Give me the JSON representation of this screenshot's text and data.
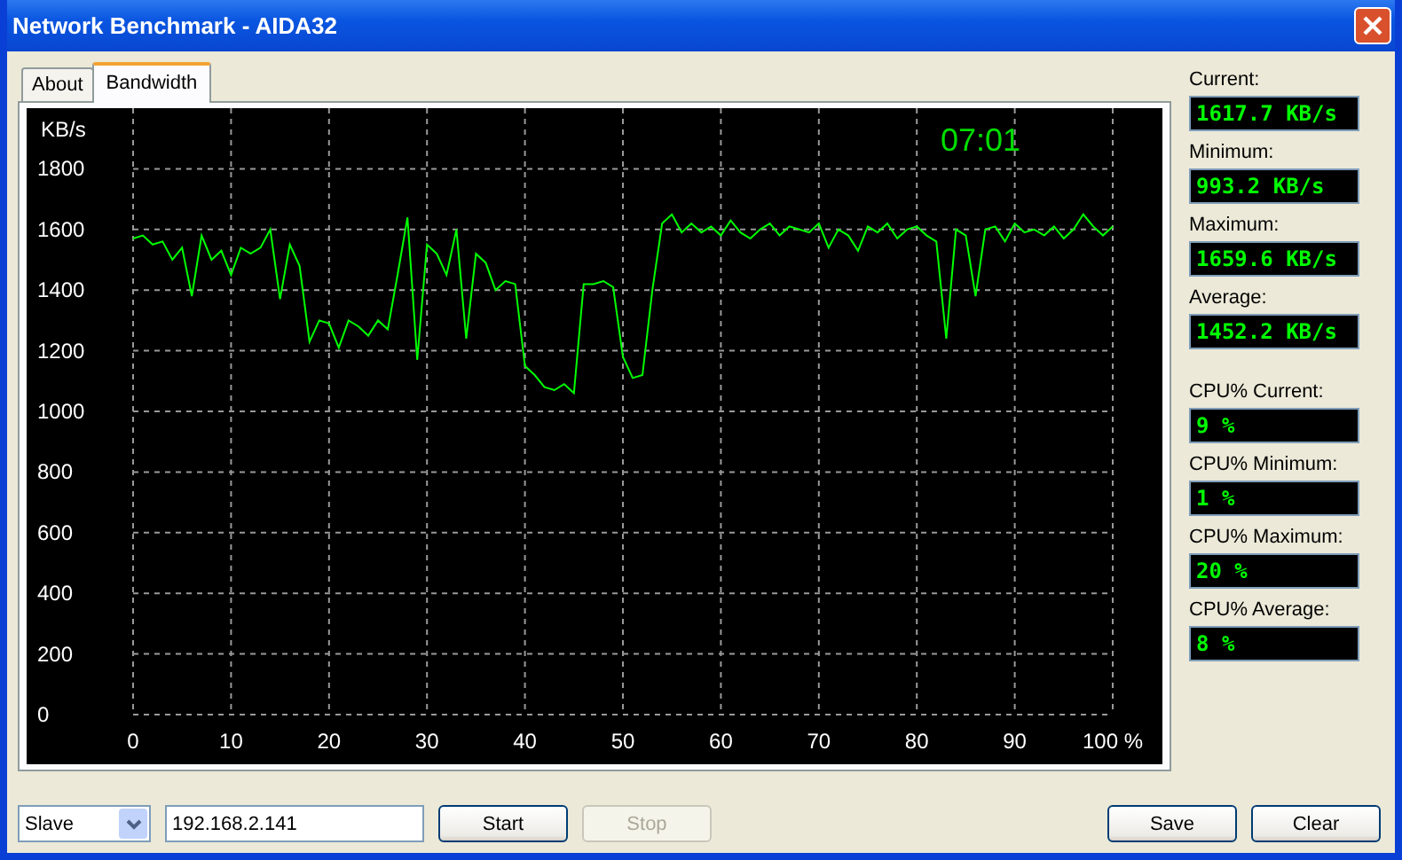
{
  "window": {
    "title": "Network Benchmark - AIDA32"
  },
  "tabs": [
    {
      "label": "About",
      "selected": false
    },
    {
      "label": "Bandwidth",
      "selected": true
    }
  ],
  "graph": {
    "timer": "07:01",
    "chart_data": {
      "type": "line",
      "ylabel": "KB/s",
      "x": [
        0,
        1,
        2,
        3,
        4,
        5,
        6,
        7,
        8,
        9,
        10,
        11,
        12,
        13,
        14,
        15,
        16,
        17,
        18,
        19,
        20,
        21,
        22,
        23,
        24,
        25,
        26,
        27,
        28,
        29,
        30,
        31,
        32,
        33,
        34,
        35,
        36,
        37,
        38,
        39,
        40,
        41,
        42,
        43,
        44,
        45,
        46,
        47,
        48,
        49,
        50,
        51,
        52,
        53,
        54,
        55,
        56,
        57,
        58,
        59,
        60,
        61,
        62,
        63,
        64,
        65,
        66,
        67,
        68,
        69,
        70,
        71,
        72,
        73,
        74,
        75,
        76,
        77,
        78,
        79,
        80,
        81,
        82,
        83,
        84,
        85,
        86,
        87,
        88,
        89,
        90,
        91,
        92,
        93,
        94,
        95,
        96,
        97,
        98,
        99,
        100
      ],
      "series": [
        {
          "color": "#00ff00",
          "values": [
            1570,
            1580,
            1550,
            1560,
            1500,
            1540,
            1380,
            1580,
            1500,
            1530,
            1450,
            1540,
            1520,
            1540,
            1600,
            1370,
            1550,
            1480,
            1230,
            1300,
            1290,
            1210,
            1300,
            1280,
            1250,
            1300,
            1270,
            1450,
            1640,
            1170,
            1550,
            1520,
            1450,
            1600,
            1240,
            1520,
            1490,
            1400,
            1430,
            1420,
            1150,
            1120,
            1080,
            1070,
            1090,
            1060,
            1420,
            1420,
            1430,
            1410,
            1180,
            1110,
            1120,
            1400,
            1620,
            1650,
            1590,
            1620,
            1590,
            1610,
            1580,
            1630,
            1590,
            1570,
            1600,
            1620,
            1580,
            1610,
            1600,
            1590,
            1620,
            1540,
            1600,
            1580,
            1530,
            1610,
            1590,
            1620,
            1570,
            1600,
            1610,
            1580,
            1560,
            1240,
            1600,
            1580,
            1380,
            1600,
            1610,
            1560,
            1620,
            1590,
            1600,
            1580,
            1610,
            1570,
            1600,
            1650,
            1610,
            1580,
            1610
          ]
        }
      ],
      "grid": true,
      "xlim": [
        0,
        100
      ],
      "ylim": [
        0,
        2000
      ],
      "xticks": [
        0,
        10,
        20,
        30,
        40,
        50,
        60,
        70,
        80,
        90,
        {
          "value": 100,
          "label": "100 %"
        }
      ],
      "yticks": [
        0,
        200,
        400,
        600,
        800,
        1000,
        1200,
        1400,
        1600,
        1800
      ]
    }
  },
  "stats": [
    {
      "label": "Current:",
      "value": "1617.7 KB/s"
    },
    {
      "label": "Minimum:",
      "value": "993.2 KB/s"
    },
    {
      "label": "Maximum:",
      "value": "1659.6 KB/s"
    },
    {
      "label": "Average:",
      "value": "1452.2 KB/s"
    },
    {
      "label": "CPU% Current:",
      "value": "9 %"
    },
    {
      "label": "CPU% Minimum:",
      "value": "1 %"
    },
    {
      "label": "CPU% Maximum:",
      "value": "20 %"
    },
    {
      "label": "CPU% Average:",
      "value": "8 %"
    }
  ],
  "mode": {
    "value": "Slave"
  },
  "address": {
    "value": "192.168.2.141"
  },
  "buttons": [
    {
      "label": "Start",
      "disabled": false
    },
    {
      "label": "Stop",
      "disabled": true
    },
    {
      "label": "Save",
      "disabled": false
    },
    {
      "label": "Clear",
      "disabled": false
    }
  ]
}
